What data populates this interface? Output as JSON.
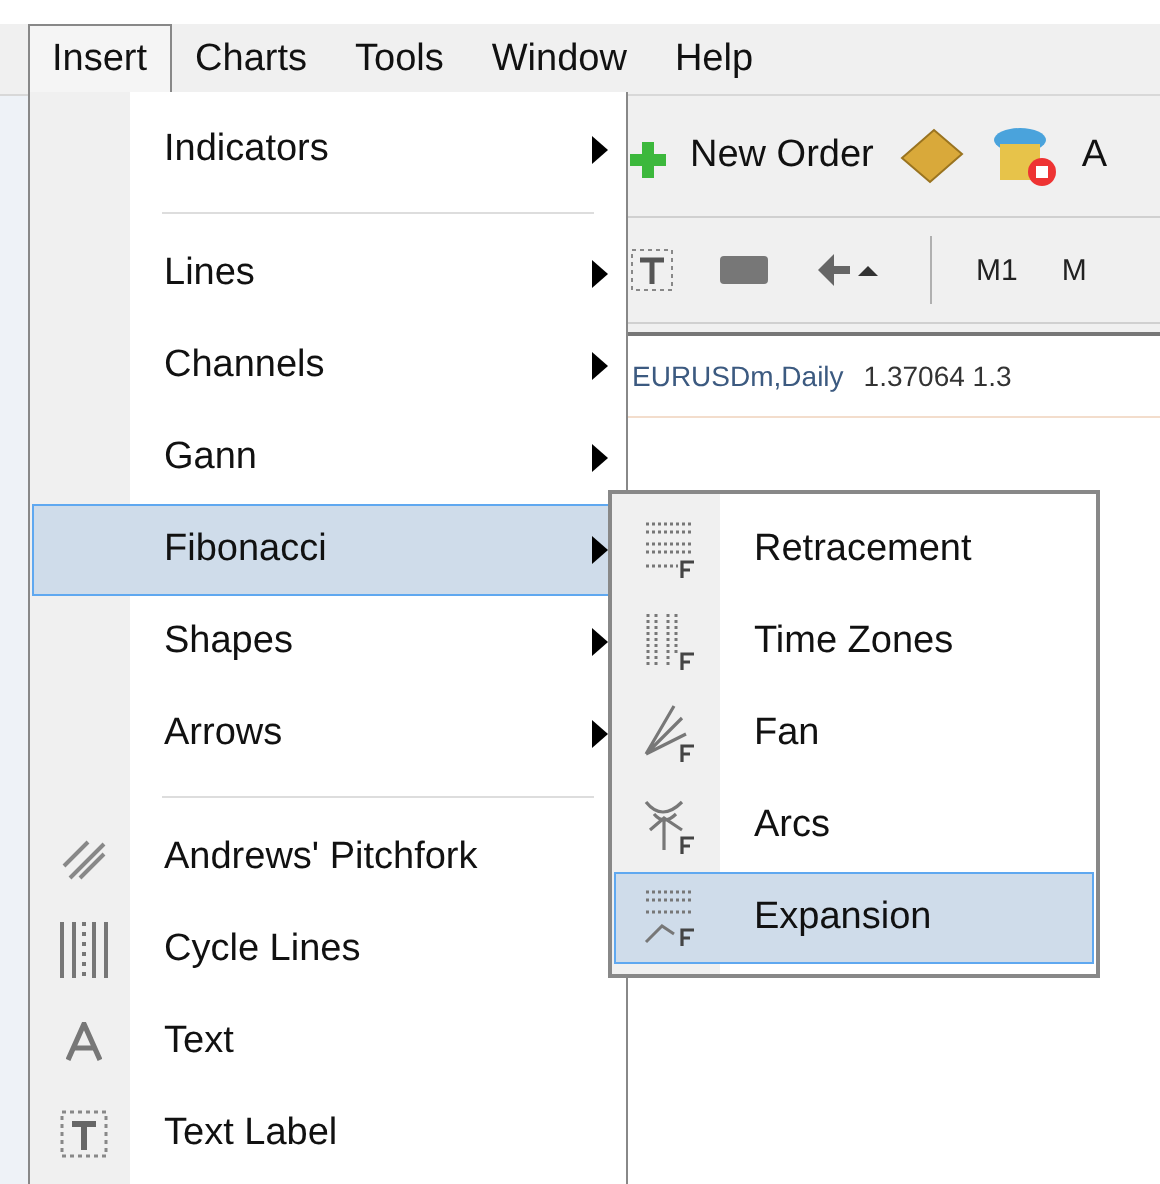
{
  "menubar": [
    {
      "label": "Insert",
      "selected": true
    },
    {
      "label": "Charts",
      "selected": false
    },
    {
      "label": "Tools",
      "selected": false
    },
    {
      "label": "Window",
      "selected": false
    },
    {
      "label": "Help",
      "selected": false
    }
  ],
  "toolbar": {
    "new_order": "New Order",
    "cut_label": "A"
  },
  "timeframes": [
    "M1",
    "M"
  ],
  "chart": {
    "symbol": "EURUSDm,Daily",
    "prices": "1.37064 1.3"
  },
  "menu": {
    "items": [
      {
        "kind": "submenu",
        "label": "Indicators",
        "selected": false
      },
      {
        "kind": "separator"
      },
      {
        "kind": "submenu",
        "label": "Lines",
        "selected": false
      },
      {
        "kind": "submenu",
        "label": "Channels",
        "selected": false
      },
      {
        "kind": "submenu",
        "label": "Gann",
        "selected": false
      },
      {
        "kind": "submenu",
        "label": "Fibonacci",
        "selected": true,
        "children": [
          {
            "label": "Retracement",
            "selected": false
          },
          {
            "label": "Time Zones",
            "selected": false
          },
          {
            "label": "Fan",
            "selected": false
          },
          {
            "label": "Arcs",
            "selected": false
          },
          {
            "label": "Expansion",
            "selected": true
          }
        ]
      },
      {
        "kind": "submenu",
        "label": "Shapes",
        "selected": false
      },
      {
        "kind": "submenu",
        "label": "Arrows",
        "selected": false
      },
      {
        "kind": "separator"
      },
      {
        "kind": "command",
        "label": "Andrews' Pitchfork",
        "selected": false
      },
      {
        "kind": "command",
        "label": "Cycle Lines",
        "selected": false
      },
      {
        "kind": "command",
        "label": "Text",
        "selected": false
      },
      {
        "kind": "command",
        "label": "Text Label",
        "selected": false
      }
    ]
  }
}
